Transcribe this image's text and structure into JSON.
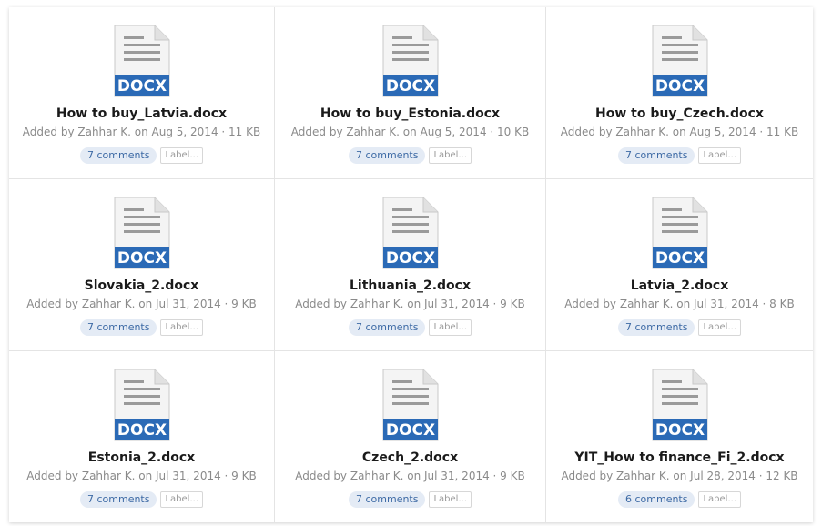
{
  "colors": {
    "docx_badge": "#2b6ab6",
    "comments_bg": "#e4ebf5",
    "comments_text": "#3d6aa5"
  },
  "files": [
    {
      "name": "How to buy_Latvia.docx",
      "meta": "Added by Zahhar K. on Aug 5, 2014 · 11 KB",
      "comments": "7 comments",
      "label": "Label...",
      "badge": "DOCX",
      "icon": "docx-file-icon"
    },
    {
      "name": "How to buy_Estonia.docx",
      "meta": "Added by Zahhar K. on Aug 5, 2014 · 10 KB",
      "comments": "7 comments",
      "label": "Label...",
      "badge": "DOCX",
      "icon": "docx-file-icon"
    },
    {
      "name": "How to buy_Czech.docx",
      "meta": "Added by Zahhar K. on Aug 5, 2014 · 11 KB",
      "comments": "7 comments",
      "label": "Label...",
      "badge": "DOCX",
      "icon": "docx-file-icon"
    },
    {
      "name": "Slovakia_2.docx",
      "meta": "Added by Zahhar K. on Jul 31, 2014 · 9 KB",
      "comments": "7 comments",
      "label": "Label...",
      "badge": "DOCX",
      "icon": "docx-file-icon"
    },
    {
      "name": "Lithuania_2.docx",
      "meta": "Added by Zahhar K. on Jul 31, 2014 · 9 KB",
      "comments": "7 comments",
      "label": "Label...",
      "badge": "DOCX",
      "icon": "docx-file-icon"
    },
    {
      "name": "Latvia_2.docx",
      "meta": "Added by Zahhar K. on Jul 31, 2014 · 8 KB",
      "comments": "7 comments",
      "label": "Label...",
      "badge": "DOCX",
      "icon": "docx-file-icon"
    },
    {
      "name": "Estonia_2.docx",
      "meta": "Added by Zahhar K. on Jul 31, 2014 · 9 KB",
      "comments": "7 comments",
      "label": "Label...",
      "badge": "DOCX",
      "icon": "docx-file-icon"
    },
    {
      "name": "Czech_2.docx",
      "meta": "Added by Zahhar K. on Jul 31, 2014 · 9 KB",
      "comments": "7 comments",
      "label": "Label...",
      "badge": "DOCX",
      "icon": "docx-file-icon"
    },
    {
      "name": "YIT_How to finance_Fi_2.docx",
      "meta": "Added by Zahhar K. on Jul 28, 2014 · 12 KB",
      "comments": "6 comments",
      "label": "Label...",
      "badge": "DOCX",
      "icon": "docx-file-icon"
    }
  ]
}
